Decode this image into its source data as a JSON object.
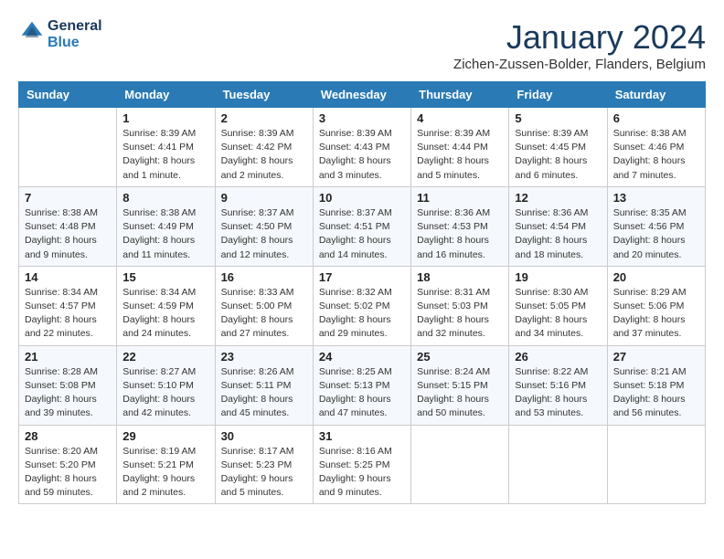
{
  "header": {
    "logo": {
      "general": "General",
      "blue": "Blue"
    },
    "title": "January 2024",
    "location": "Zichen-Zussen-Bolder, Flanders, Belgium"
  },
  "calendar": {
    "days_of_week": [
      "Sunday",
      "Monday",
      "Tuesday",
      "Wednesday",
      "Thursday",
      "Friday",
      "Saturday"
    ],
    "weeks": [
      [
        {
          "day": "",
          "sunrise": "",
          "sunset": "",
          "daylight": ""
        },
        {
          "day": "1",
          "sunrise": "Sunrise: 8:39 AM",
          "sunset": "Sunset: 4:41 PM",
          "daylight": "Daylight: 8 hours and 1 minute."
        },
        {
          "day": "2",
          "sunrise": "Sunrise: 8:39 AM",
          "sunset": "Sunset: 4:42 PM",
          "daylight": "Daylight: 8 hours and 2 minutes."
        },
        {
          "day": "3",
          "sunrise": "Sunrise: 8:39 AM",
          "sunset": "Sunset: 4:43 PM",
          "daylight": "Daylight: 8 hours and 3 minutes."
        },
        {
          "day": "4",
          "sunrise": "Sunrise: 8:39 AM",
          "sunset": "Sunset: 4:44 PM",
          "daylight": "Daylight: 8 hours and 5 minutes."
        },
        {
          "day": "5",
          "sunrise": "Sunrise: 8:39 AM",
          "sunset": "Sunset: 4:45 PM",
          "daylight": "Daylight: 8 hours and 6 minutes."
        },
        {
          "day": "6",
          "sunrise": "Sunrise: 8:38 AM",
          "sunset": "Sunset: 4:46 PM",
          "daylight": "Daylight: 8 hours and 7 minutes."
        }
      ],
      [
        {
          "day": "7",
          "sunrise": "Sunrise: 8:38 AM",
          "sunset": "Sunset: 4:48 PM",
          "daylight": "Daylight: 8 hours and 9 minutes."
        },
        {
          "day": "8",
          "sunrise": "Sunrise: 8:38 AM",
          "sunset": "Sunset: 4:49 PM",
          "daylight": "Daylight: 8 hours and 11 minutes."
        },
        {
          "day": "9",
          "sunrise": "Sunrise: 8:37 AM",
          "sunset": "Sunset: 4:50 PM",
          "daylight": "Daylight: 8 hours and 12 minutes."
        },
        {
          "day": "10",
          "sunrise": "Sunrise: 8:37 AM",
          "sunset": "Sunset: 4:51 PM",
          "daylight": "Daylight: 8 hours and 14 minutes."
        },
        {
          "day": "11",
          "sunrise": "Sunrise: 8:36 AM",
          "sunset": "Sunset: 4:53 PM",
          "daylight": "Daylight: 8 hours and 16 minutes."
        },
        {
          "day": "12",
          "sunrise": "Sunrise: 8:36 AM",
          "sunset": "Sunset: 4:54 PM",
          "daylight": "Daylight: 8 hours and 18 minutes."
        },
        {
          "day": "13",
          "sunrise": "Sunrise: 8:35 AM",
          "sunset": "Sunset: 4:56 PM",
          "daylight": "Daylight: 8 hours and 20 minutes."
        }
      ],
      [
        {
          "day": "14",
          "sunrise": "Sunrise: 8:34 AM",
          "sunset": "Sunset: 4:57 PM",
          "daylight": "Daylight: 8 hours and 22 minutes."
        },
        {
          "day": "15",
          "sunrise": "Sunrise: 8:34 AM",
          "sunset": "Sunset: 4:59 PM",
          "daylight": "Daylight: 8 hours and 24 minutes."
        },
        {
          "day": "16",
          "sunrise": "Sunrise: 8:33 AM",
          "sunset": "Sunset: 5:00 PM",
          "daylight": "Daylight: 8 hours and 27 minutes."
        },
        {
          "day": "17",
          "sunrise": "Sunrise: 8:32 AM",
          "sunset": "Sunset: 5:02 PM",
          "daylight": "Daylight: 8 hours and 29 minutes."
        },
        {
          "day": "18",
          "sunrise": "Sunrise: 8:31 AM",
          "sunset": "Sunset: 5:03 PM",
          "daylight": "Daylight: 8 hours and 32 minutes."
        },
        {
          "day": "19",
          "sunrise": "Sunrise: 8:30 AM",
          "sunset": "Sunset: 5:05 PM",
          "daylight": "Daylight: 8 hours and 34 minutes."
        },
        {
          "day": "20",
          "sunrise": "Sunrise: 8:29 AM",
          "sunset": "Sunset: 5:06 PM",
          "daylight": "Daylight: 8 hours and 37 minutes."
        }
      ],
      [
        {
          "day": "21",
          "sunrise": "Sunrise: 8:28 AM",
          "sunset": "Sunset: 5:08 PM",
          "daylight": "Daylight: 8 hours and 39 minutes."
        },
        {
          "day": "22",
          "sunrise": "Sunrise: 8:27 AM",
          "sunset": "Sunset: 5:10 PM",
          "daylight": "Daylight: 8 hours and 42 minutes."
        },
        {
          "day": "23",
          "sunrise": "Sunrise: 8:26 AM",
          "sunset": "Sunset: 5:11 PM",
          "daylight": "Daylight: 8 hours and 45 minutes."
        },
        {
          "day": "24",
          "sunrise": "Sunrise: 8:25 AM",
          "sunset": "Sunset: 5:13 PM",
          "daylight": "Daylight: 8 hours and 47 minutes."
        },
        {
          "day": "25",
          "sunrise": "Sunrise: 8:24 AM",
          "sunset": "Sunset: 5:15 PM",
          "daylight": "Daylight: 8 hours and 50 minutes."
        },
        {
          "day": "26",
          "sunrise": "Sunrise: 8:22 AM",
          "sunset": "Sunset: 5:16 PM",
          "daylight": "Daylight: 8 hours and 53 minutes."
        },
        {
          "day": "27",
          "sunrise": "Sunrise: 8:21 AM",
          "sunset": "Sunset: 5:18 PM",
          "daylight": "Daylight: 8 hours and 56 minutes."
        }
      ],
      [
        {
          "day": "28",
          "sunrise": "Sunrise: 8:20 AM",
          "sunset": "Sunset: 5:20 PM",
          "daylight": "Daylight: 8 hours and 59 minutes."
        },
        {
          "day": "29",
          "sunrise": "Sunrise: 8:19 AM",
          "sunset": "Sunset: 5:21 PM",
          "daylight": "Daylight: 9 hours and 2 minutes."
        },
        {
          "day": "30",
          "sunrise": "Sunrise: 8:17 AM",
          "sunset": "Sunset: 5:23 PM",
          "daylight": "Daylight: 9 hours and 5 minutes."
        },
        {
          "day": "31",
          "sunrise": "Sunrise: 8:16 AM",
          "sunset": "Sunset: 5:25 PM",
          "daylight": "Daylight: 9 hours and 9 minutes."
        },
        {
          "day": "",
          "sunrise": "",
          "sunset": "",
          "daylight": ""
        },
        {
          "day": "",
          "sunrise": "",
          "sunset": "",
          "daylight": ""
        },
        {
          "day": "",
          "sunrise": "",
          "sunset": "",
          "daylight": ""
        }
      ]
    ]
  }
}
